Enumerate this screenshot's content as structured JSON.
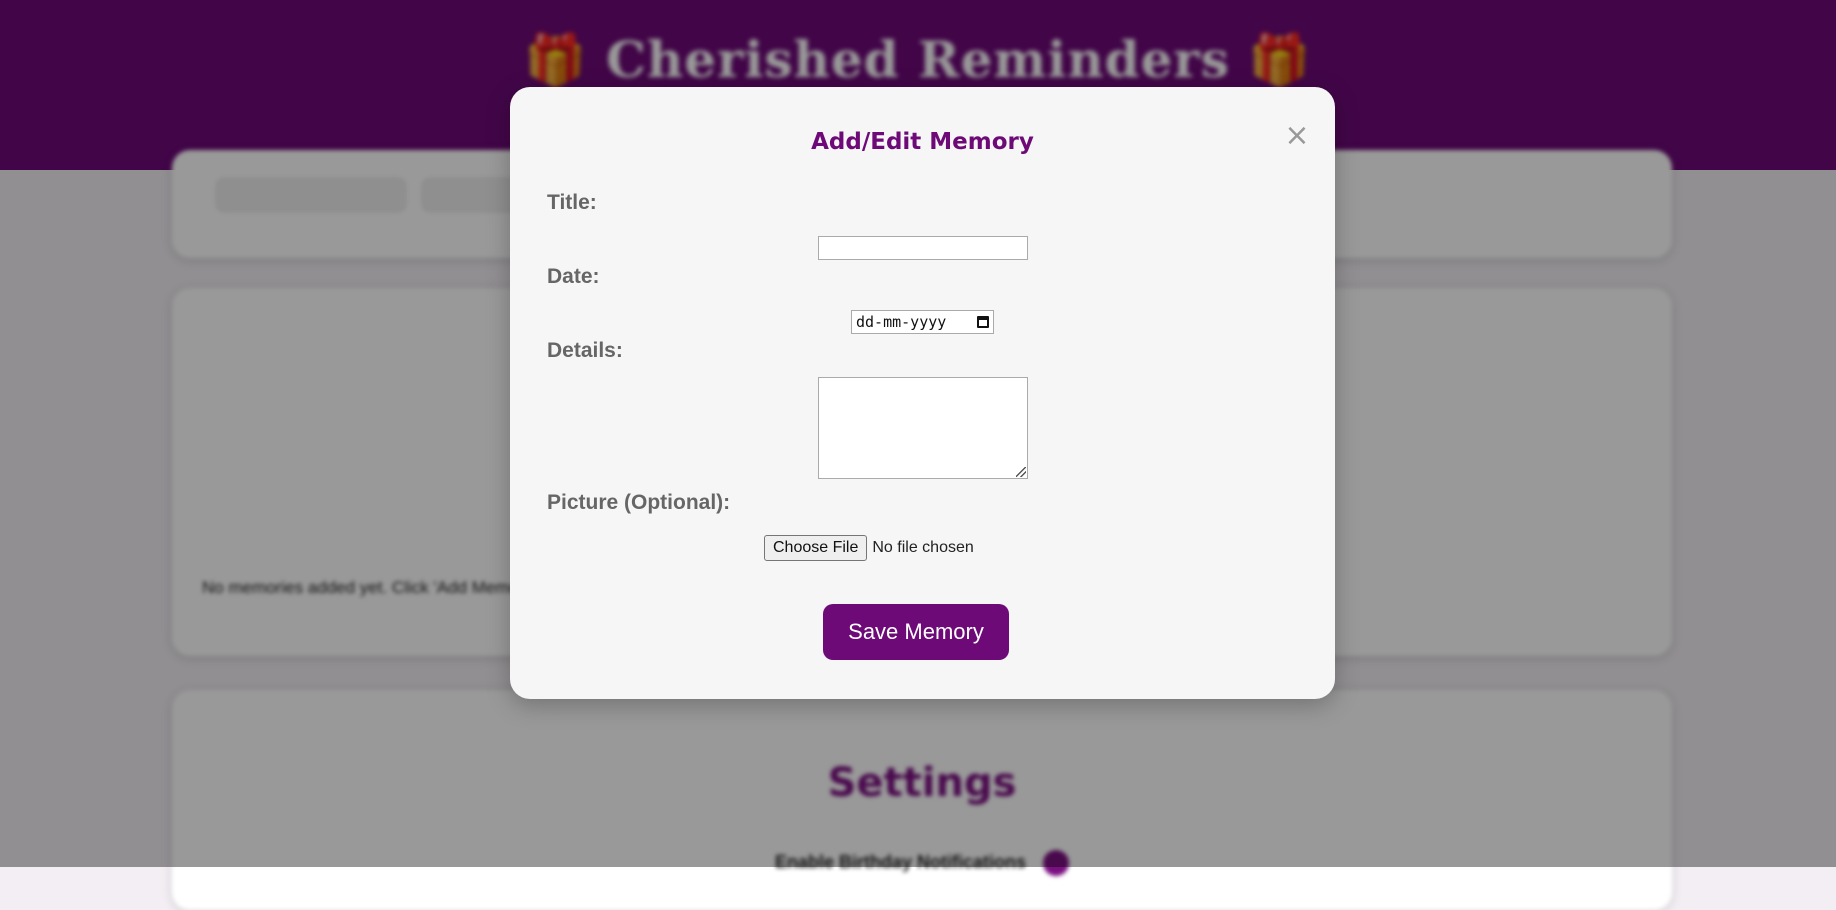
{
  "background": {
    "app_title": "Cherished Reminders",
    "gift_icon": "🎁",
    "empty_message": "No memories added yet. Click 'Add Memory'",
    "settings_title": "Settings",
    "settings_toggle_label": "Enable Birthday Notifications"
  },
  "modal": {
    "title": "Add/Edit Memory",
    "close_icon": "×",
    "labels": {
      "title": "Title:",
      "date": "Date:",
      "details": "Details:",
      "picture": "Picture (Optional):"
    },
    "fields": {
      "title_value": "",
      "date_placeholder": "dd-mm-yyyy",
      "details_value": "",
      "file_button": "Choose File",
      "file_status": "No file chosen"
    },
    "save_button": "Save Memory"
  },
  "colors": {
    "brand_purple": "#6e0a78",
    "modal_bg": "#f6f6f6",
    "label_gray": "#666666"
  }
}
